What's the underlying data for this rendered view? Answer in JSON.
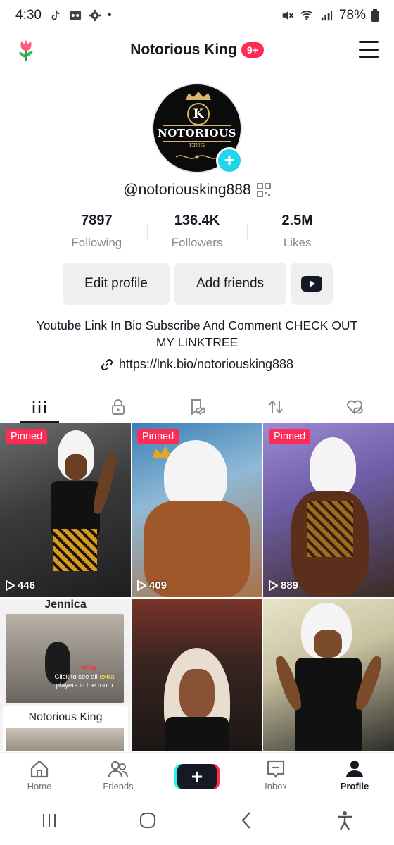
{
  "status_bar": {
    "time": "4:30",
    "battery": "78%"
  },
  "header": {
    "title": "Notorious King",
    "badge": "9+"
  },
  "avatar": {
    "brand": "NOTORIOUS",
    "sub": "KING",
    "initial": "K"
  },
  "profile": {
    "handle": "@notoriousking888"
  },
  "stats": [
    {
      "value": "7897",
      "label": "Following"
    },
    {
      "value": "136.4K",
      "label": "Followers"
    },
    {
      "value": "2.5M",
      "label": "Likes"
    }
  ],
  "buttons": {
    "edit": "Edit profile",
    "add": "Add friends"
  },
  "bio": {
    "text": "Youtube Link In Bio Subscribe And Comment CHECK OUT MY LINKTREE",
    "link": "https://lnk.bio/notoriousking888"
  },
  "videos": [
    {
      "pinned": "Pinned",
      "views": "446"
    },
    {
      "pinned": "Pinned",
      "views": "409"
    },
    {
      "pinned": "Pinned",
      "views": "889"
    },
    {
      "thumb_title": "Jennica",
      "note_new": "← NEW",
      "note_text_a": "Click to see all",
      "note_extra": "extra",
      "note_text_b": "players in the room",
      "thumb_subtitle": "Notorious King"
    },
    {},
    {}
  ],
  "bottom_nav": {
    "home": "Home",
    "friends": "Friends",
    "inbox": "Inbox",
    "profile": "Profile"
  },
  "colors": {
    "accent": "#fe2c55",
    "cyan": "#20d5ec",
    "text": "#161823",
    "muted": "#8a8b91"
  }
}
